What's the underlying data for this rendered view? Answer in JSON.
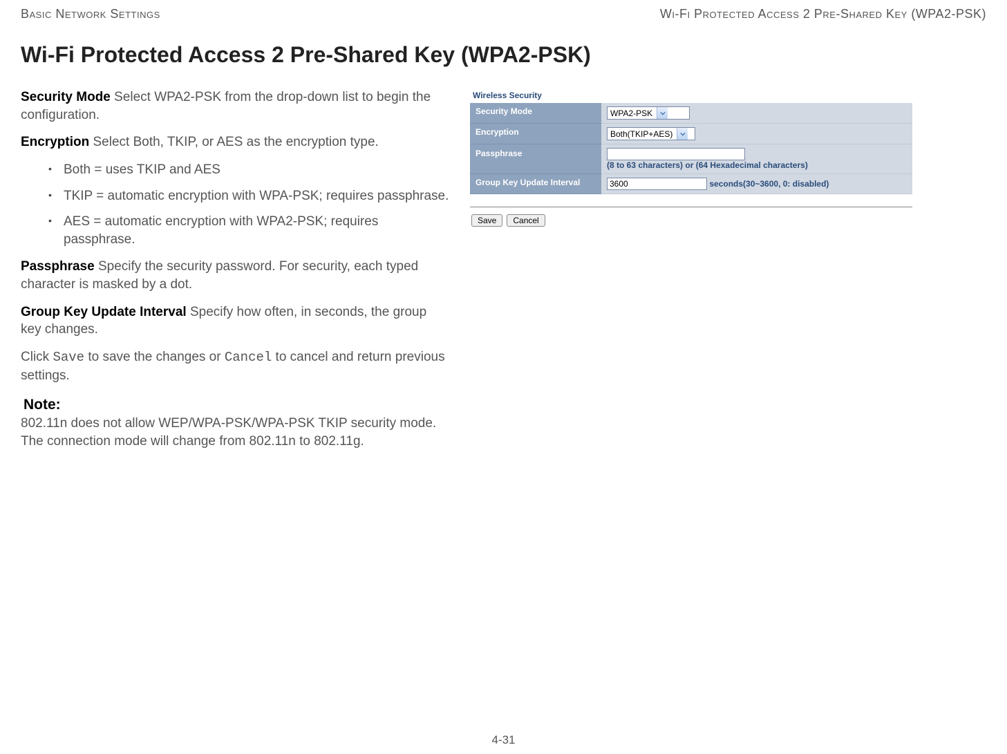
{
  "header": {
    "left": "Basic Network Settings",
    "right": "Wi-Fi Protected Access 2 Pre-Shared Key (WPA2-PSK)"
  },
  "title": "Wi-Fi Protected Access 2 Pre-Shared Key (WPA2-PSK)",
  "body": {
    "security_mode_label": "Security Mode",
    "security_mode_text": "  Select WPA2-PSK from the drop-down list to begin the configuration.",
    "encryption_label": "Encryption",
    "encryption_text": "  Select Both, TKIP, or AES as the encryption type.",
    "bullets": [
      "Both = uses TKIP and AES",
      "TKIP = automatic encryption with WPA-PSK; requires passphrase.",
      "AES = automatic encryption with WPA2-PSK; requires passphrase."
    ],
    "passphrase_label": "Passphrase",
    "passphrase_text": "  Specify the security password. For security, each typed character is masked by a dot.",
    "gkui_label": "Group Key Update Interval",
    "gkui_text": "  Specify how often, in seconds, the group key changes.",
    "save_sentence_pre": "Click ",
    "save_word": "Save",
    "save_sentence_mid": " to save the changes or ",
    "cancel_word": "Cancel",
    "save_sentence_post": " to cancel and return previous settings.",
    "note_heading": "Note:",
    "note_body": "802.11n does not allow WEP/WPA-PSK/WPA-PSK TKIP security mode. The connection mode will change from 802.11n to 802.11g."
  },
  "panel": {
    "section_title": "Wireless Security",
    "rows": {
      "security_mode": {
        "label": "Security Mode",
        "value": "WPA2-PSK"
      },
      "encryption": {
        "label": "Encryption",
        "value": "Both(TKIP+AES)"
      },
      "passphrase": {
        "label": "Passphrase",
        "value": "",
        "hint": "(8 to 63 characters) or (64 Hexadecimal characters)"
      },
      "group_key": {
        "label": "Group Key Update Interval",
        "value": "3600",
        "hint": "seconds(30~3600, 0: disabled)"
      }
    },
    "buttons": {
      "save": "Save",
      "cancel": "Cancel"
    }
  },
  "page_number": "4-31"
}
